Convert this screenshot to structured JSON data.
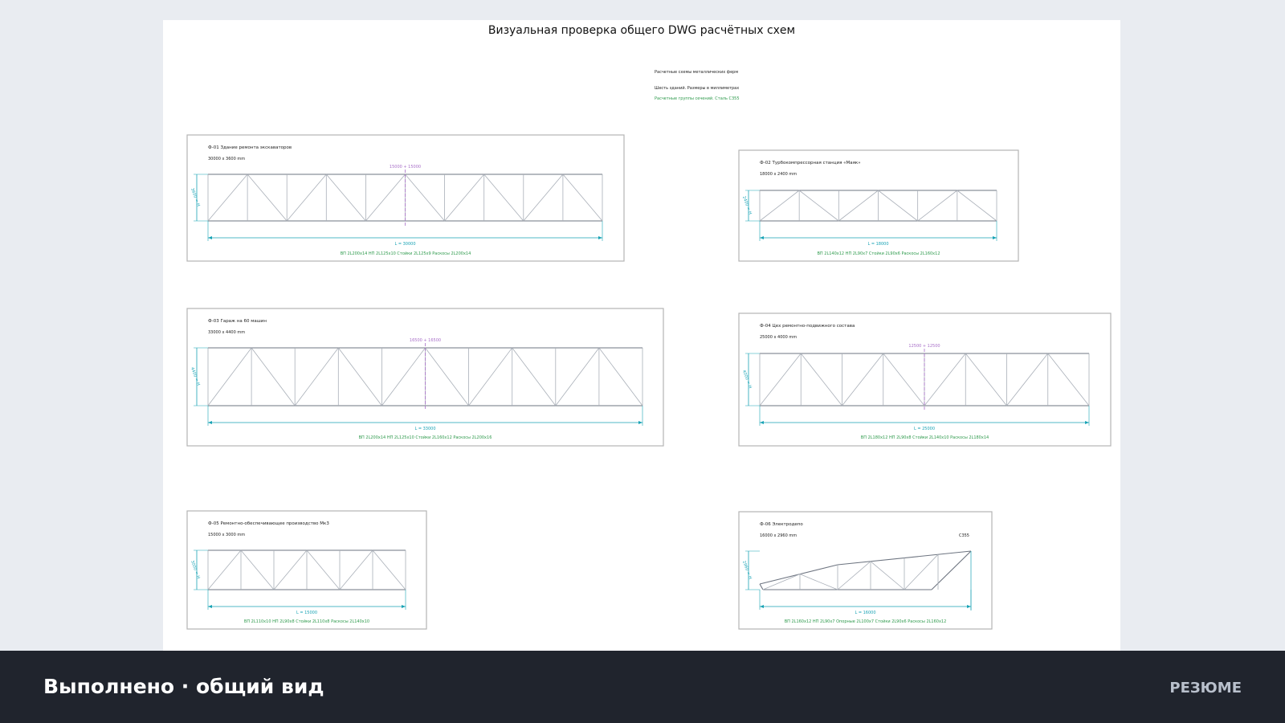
{
  "window": {
    "title": "Визуальная проверка общего DWG расчётных схем"
  },
  "sheet_header": {
    "line1": "Расчетные схемы металлических ферм",
    "line2": "Шесть зданий. Размеры в миллиметрах",
    "line3": "Расчетные группы сечений. Сталь С355"
  },
  "trusses": [
    {
      "id": "Ф-01",
      "name": "Здание ремонта экскаваторов",
      "size": "30000 x 3600 mm",
      "span": 30000,
      "height": 3600,
      "panels": 10,
      "span_label": "L = 30000",
      "half_label": "15000 + 15000",
      "height_label": "3600 = H",
      "sections": "ВП 2L200x14   НП 2L125x10   Стойки 2L125x9   Раскосы 2L200x14"
    },
    {
      "id": "Ф-02",
      "name": "Турбокомпрессорная станция «Маяк»",
      "size": "18000 x 2400 mm",
      "span": 18000,
      "height": 2400,
      "panels": 6,
      "span_label": "L = 18000",
      "half_label": "",
      "height_label": "2400 = H",
      "sections": "ВП 2L140x12   НП 2L90x7   Стойки 2L90x6   Раскосы 2L160x12"
    },
    {
      "id": "Ф-03",
      "name": "Гараж на 60 машин",
      "size": "33000 x 4400 mm",
      "span": 33000,
      "height": 4400,
      "panels": 10,
      "span_label": "L = 33000",
      "half_label": "16500 + 16500",
      "height_label": "4400 = H",
      "sections": "ВП 2L200x14   НП 2L125x10   Стойки 2L160x12   Раскосы 2L200x16"
    },
    {
      "id": "Ф-04",
      "name": "Цех ремонтно-подвижного состава",
      "size": "25000 x 4000 mm",
      "span": 25000,
      "height": 4000,
      "panels": 8,
      "span_label": "L = 25000",
      "half_label": "12500 + 12500",
      "height_label": "4000 = H",
      "sections": "ВП 2L180x12   НП 2L90x8   Стойки 2L140x10   Раскосы 2L180x14"
    },
    {
      "id": "Ф-05",
      "name": "Ремонтно-обеспечивающее производство Мк3",
      "size": "15000 x 3000 mm",
      "span": 15000,
      "height": 3000,
      "panels": 6,
      "span_label": "L = 15000",
      "half_label": "",
      "height_label": "3000 = H",
      "sections": "ВП 2L110x10   НП 2L90x8   Стойки 2L110x8   Раскосы 2L140x10"
    },
    {
      "id": "Ф-06",
      "name": "Электродепо",
      "size": "16000 x 2960 mm",
      "span": 16000,
      "height": 2960,
      "panels": 6,
      "steel": "С355",
      "span_label": "L = 16000",
      "half_label": "",
      "height_label": "2960 = H",
      "sections": "ВП 2L160x12   НП 2L90x7   Опорные 2L100x7   Стойки 2L90x6   Раскосы 2L160x12"
    }
  ],
  "colors": {
    "frame": "#b4b4b4",
    "member": "#a9afb8",
    "chord": "#6d7480",
    "dimension": "#19a3b5",
    "center": "#a86fc8",
    "sections": "#2e9a4c",
    "text": "#222222"
  },
  "footer": {
    "status": "Выполнено · общий вид",
    "resume_label": "РЕЗЮМЕ"
  }
}
